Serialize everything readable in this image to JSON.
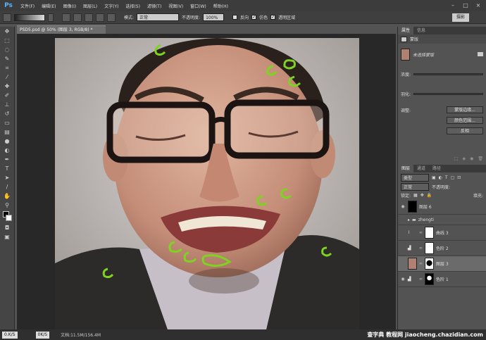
{
  "app": {
    "logo": "Ps",
    "menus": [
      "文件(F)",
      "编辑(E)",
      "图像(I)",
      "图层(L)",
      "文字(Y)",
      "选择(S)",
      "滤镜(T)",
      "视图(V)",
      "窗口(W)",
      "帮助(H)"
    ],
    "window_controls": [
      "–",
      "□",
      "×"
    ]
  },
  "options_bar": {
    "mode_label": "模式:",
    "mode_value": "正常",
    "opacity_label": "不透明度:",
    "opacity_value": "100%",
    "reverse_label": "反向",
    "dither_label": "仿色",
    "transparency_label": "透明区域",
    "workspace_button": "摄影"
  },
  "document": {
    "tab_title": "PSD5.psd @ 50% (图层 3, RGB/8) *"
  },
  "status_bar": {
    "zoom_left": "0.K/S",
    "zoom_right": "0K/S",
    "doc_info": "文档:11.5M/156.4M"
  },
  "properties_panel": {
    "tabs": [
      "属性",
      "信息"
    ],
    "title": "蒙版",
    "mask_label": "未选择蒙版",
    "density_label": "浓度:",
    "feather_label": "羽化:",
    "adjust_label": "调整:",
    "buttons": [
      "蒙版边缘...",
      "颜色范围...",
      "反相"
    ]
  },
  "layers_panel": {
    "tabs": [
      "图层",
      "通道",
      "路径"
    ],
    "filter_label": "类型",
    "blend_mode": "正常",
    "opacity_label": "不透明度:",
    "lock_label": "锁定:",
    "fill_label": "填充:",
    "layers": [
      {
        "name": "图层 6",
        "type": "normal",
        "visible": true,
        "selected": false
      },
      {
        "name": "zhengti",
        "type": "group",
        "visible": false,
        "selected": false
      },
      {
        "name": "曲线 3",
        "type": "adjustment",
        "visible": false,
        "selected": false
      },
      {
        "name": "色阶 2",
        "type": "adjustment",
        "visible": false,
        "selected": false
      },
      {
        "name": "图层 3",
        "type": "photo",
        "visible": false,
        "selected": true
      },
      {
        "name": "色阶 1",
        "type": "adjustment",
        "visible": true,
        "selected": false
      }
    ]
  },
  "watermark": "查字典 教程网 jiaocheng.chazidian.com",
  "colors": {
    "annotation_green": "#7ed321",
    "accent_blue": "#5bb3ff"
  }
}
